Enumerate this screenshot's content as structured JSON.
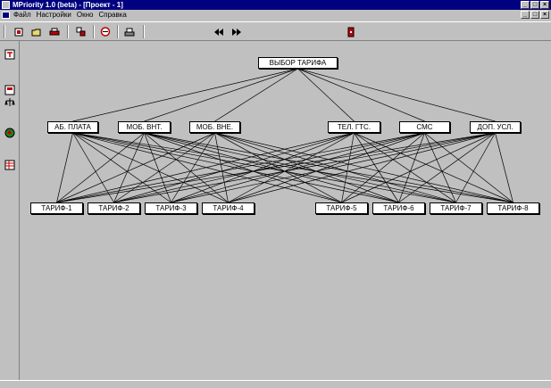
{
  "window": {
    "title": "MPriority 1.0 (beta) - [Проект - 1]"
  },
  "menu": {
    "items": [
      "Файл",
      "Настройки",
      "Окно",
      "Справка"
    ]
  },
  "colors": {
    "titlebar": "#000080",
    "background": "#c0c0c0",
    "node_fill": "#ffffff"
  },
  "toolbar": {
    "icons": [
      "new-icon",
      "open-icon",
      "print-icon",
      "matrix-icon",
      "chart-icon",
      "printer-icon",
      "back-arrow-icon",
      "forward-arrow-icon",
      "exit-icon"
    ]
  },
  "sidebar": {
    "icons": [
      "hierarchy-icon",
      "calc-icon",
      "scale-icon",
      "globe-icon",
      "table-icon"
    ]
  },
  "hierarchy": {
    "goal": "ВЫБОР ТАРИФА",
    "criteria": [
      "АБ. ПЛАТА",
      "МОБ. ВНТ.",
      "МОБ. ВНЕ.",
      "ТЕЛ. ГТС.",
      "СМС",
      "ДОП. УСЛ."
    ],
    "alternatives": [
      "ТАРИФ-1",
      "ТАРИФ-2",
      "ТАРИФ-3",
      "ТАРИФ-4",
      "ТАРИФ-5",
      "ТАРИФ-6",
      "ТАРИФ-7",
      "ТАРИФ-8"
    ]
  }
}
